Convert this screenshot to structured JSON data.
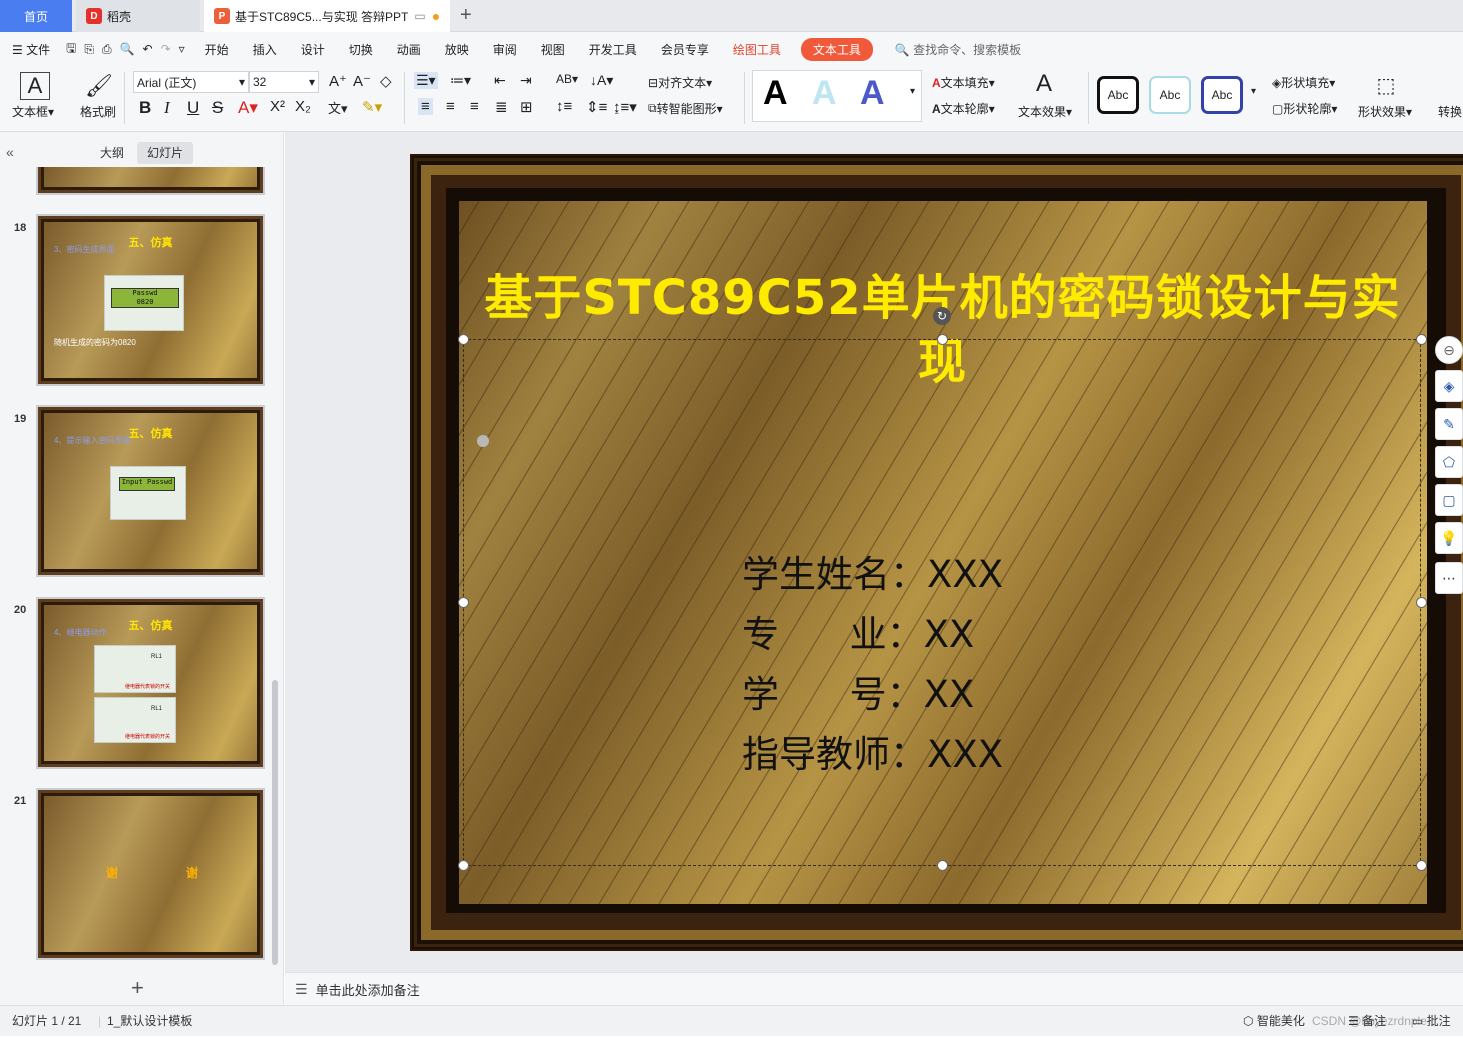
{
  "tabs": {
    "home": "首页",
    "daoke": "稻壳",
    "doc": "基于STC89C5...与实现 答辩PPT",
    "add": "+"
  },
  "menu": {
    "file": "文件",
    "items": [
      "开始",
      "插入",
      "设计",
      "切换",
      "动画",
      "放映",
      "审阅",
      "视图",
      "开发工具",
      "会员专享"
    ],
    "draw_tools": "绘图工具",
    "text_tools": "文本工具",
    "search": "查找命令、搜索模板"
  },
  "ribbon": {
    "textbox": "文本框",
    "format_painter": "格式刷",
    "font_name": "Arial (正文)",
    "font_size": "32",
    "align_text": "对齐文本",
    "smart_shape": "转智能图形",
    "text_fill": "文本填充",
    "text_outline": "文本轮廓",
    "text_effect": "文本效果",
    "abc": "Abc",
    "shape_fill": "形状填充",
    "shape_outline": "形状轮廓",
    "shape_effect": "形状效果",
    "convert": "转换"
  },
  "panel": {
    "outline_tab": "大纲",
    "slides_tab": "幻灯片",
    "add": "+"
  },
  "thumbs": [
    {
      "num": "18",
      "title": "五、仿真",
      "sub": "3、密码生成界面",
      "lcd1": "Passwd",
      "lcd2": "0820",
      "caption": "随机生成的密码为0820"
    },
    {
      "num": "19",
      "title": "五、仿真",
      "sub": "4、提示输入密码界面",
      "lcd1": "Input Passwd"
    },
    {
      "num": "20",
      "title": "五、仿真",
      "sub": "4、继电器动作",
      "relay1": "RL1",
      "relay2": "RL1",
      "cap1": "继电器代表锁的开关",
      "cap2": "继电器代表锁的开关"
    },
    {
      "num": "21",
      "left": "谢",
      "right": "谢"
    }
  ],
  "slide": {
    "title": "基于STC89C52单片机的密码锁设计与实现",
    "rows": [
      {
        "label": "学生姓名：",
        "value": "XXX"
      },
      {
        "label": "专      业：",
        "value": "XX"
      },
      {
        "label": "学      号：",
        "value": "XX"
      },
      {
        "label": "指导教师：",
        "value": "XXX"
      }
    ]
  },
  "notes": "单击此处添加备注",
  "status": {
    "slide_count": "幻灯片 1 / 21",
    "template": "1_默认设计模板",
    "beautify": "智能美化",
    "notes_btn": "备注",
    "comment_btn": "批注",
    "watermark": "CSDN @bbyezrdnple"
  },
  "colors": {
    "accent": "#4a7ef0",
    "text_tools": "#f05a3b",
    "title": "#ffeb00",
    "gold": "#b69445"
  }
}
